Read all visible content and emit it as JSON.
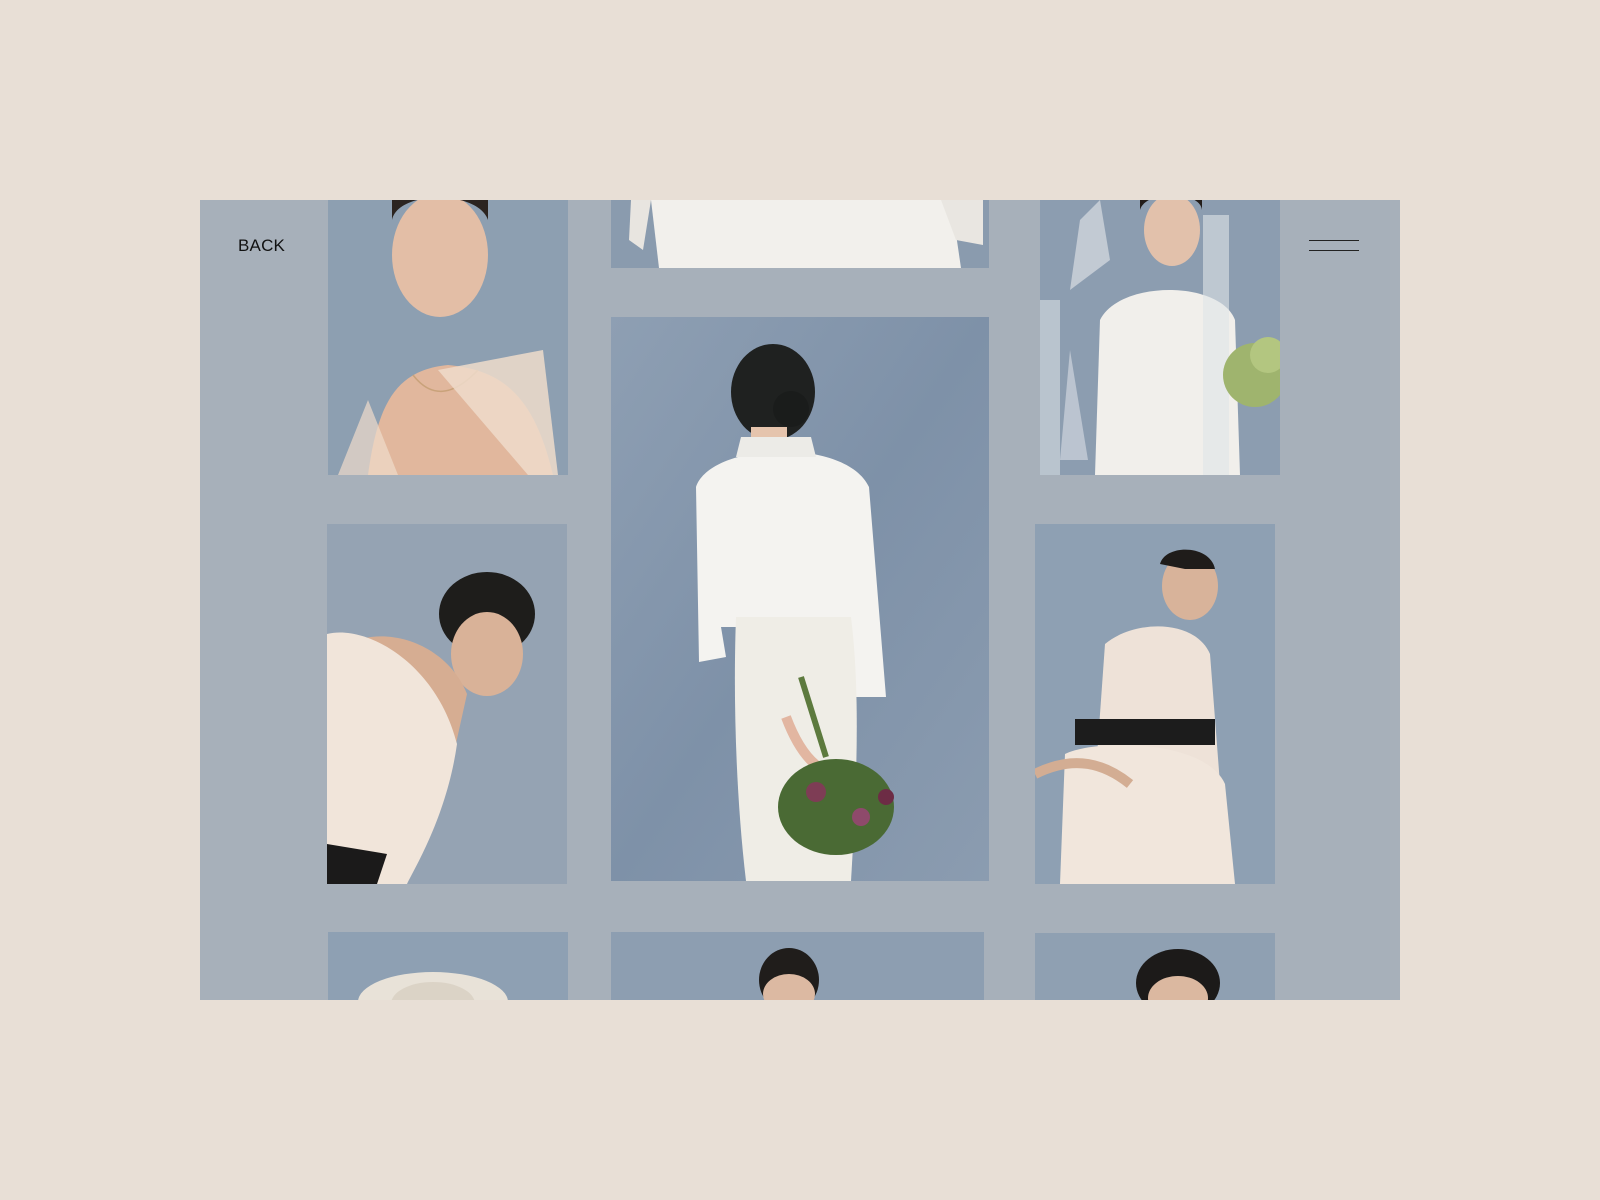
{
  "nav": {
    "back_label": "BACK",
    "menu_icon": "hamburger-icon"
  },
  "gallery": {
    "photos": [
      {
        "subject": "portrait-sequin-top"
      },
      {
        "subject": "white-dress-crop"
      },
      {
        "subject": "bride-with-veil-and-vases"
      },
      {
        "subject": "feather-top-bowing"
      },
      {
        "subject": "white-shirt-back-with-bouquet"
      },
      {
        "subject": "feather-dress-side-pose"
      },
      {
        "subject": "hat-portrait"
      },
      {
        "subject": "front-portrait-center"
      },
      {
        "subject": "front-portrait-right"
      }
    ]
  },
  "colors": {
    "page_bg": "#e8dfd6",
    "frame_bg": "#a7b0ba",
    "photo_backdrop": "#8497ab"
  }
}
